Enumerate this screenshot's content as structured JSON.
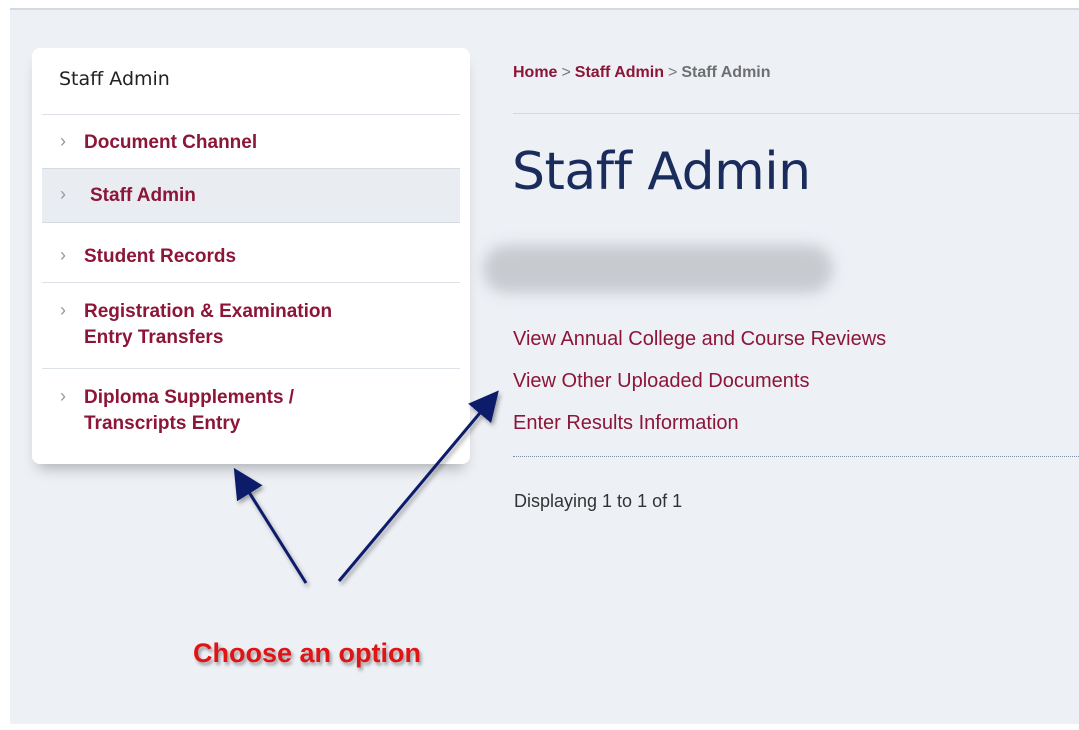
{
  "sidebar": {
    "title": "Staff Admin",
    "items": [
      {
        "label": "Document Channel"
      },
      {
        "label": "Staff Admin",
        "active": true
      },
      {
        "label": "Student Records"
      },
      {
        "label": "Registration & Examination Entry Transfers",
        "line1": "Registration & Examination",
        "line2": "Entry Transfers"
      },
      {
        "label": "Diploma Supplements / Transcripts Entry",
        "line1": "Diploma Supplements /",
        "line2": "Transcripts Entry"
      }
    ]
  },
  "breadcrumb": {
    "home": "Home",
    "sep": ">",
    "section": "Staff Admin",
    "current": "Staff Admin"
  },
  "main": {
    "title": "Staff Admin",
    "links": [
      "View Annual College and Course Reviews",
      "View Other Uploaded Documents",
      "Enter Results Information"
    ],
    "displaying": "Displaying 1 to 1 of 1"
  },
  "annotation": {
    "callout": "Choose an option"
  },
  "colors": {
    "link": "#8c1538",
    "title": "#1a2c5c",
    "callout": "#e01414",
    "arrow": "#0d1f6b"
  }
}
